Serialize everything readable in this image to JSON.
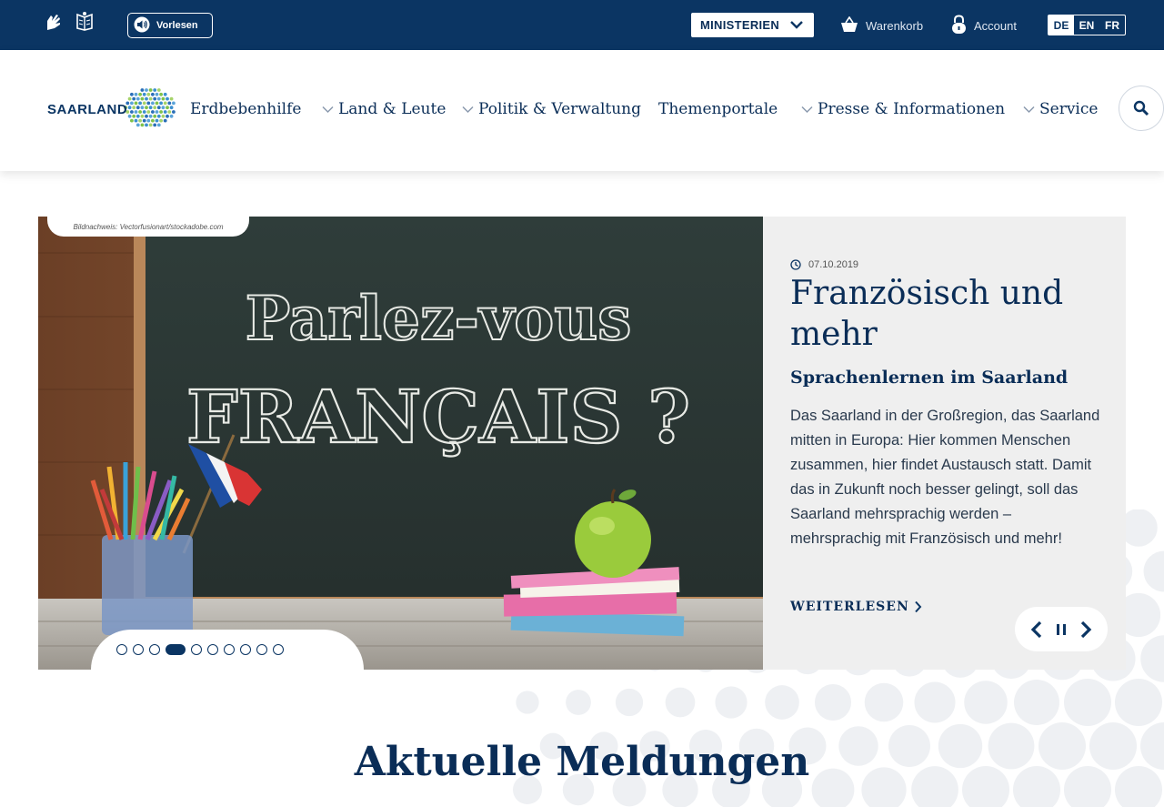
{
  "topbar": {
    "vorlesen_label": "Vorlesen",
    "ministerien_label": "MINISTERIEN",
    "cart_label": "Warenkorb",
    "account_label": "Account",
    "languages": [
      "DE",
      "EN",
      "FR"
    ],
    "active_language": "DE"
  },
  "logo": {
    "text": "SAARLAND"
  },
  "nav": {
    "items": [
      {
        "label": "Erdbebenhilfe",
        "has_dropdown": false
      },
      {
        "label": "Land & Leute",
        "has_dropdown": true
      },
      {
        "label": "Politik & Verwaltung",
        "has_dropdown": true
      },
      {
        "label": "Themenportale",
        "has_dropdown": false
      },
      {
        "label": "Presse & Informationen",
        "has_dropdown": true
      },
      {
        "label": "Service",
        "has_dropdown": true
      }
    ]
  },
  "slider": {
    "image_credit": "Bildnachweis: Vectorfusionart/stockadobe.com",
    "chalkboard_line1": "Parlez-vous",
    "chalkboard_line2": "FRANÇAIS ?",
    "date": "07.10.2019",
    "headline": "Französisch und mehr",
    "subheadline": "Sprachenlernen im Saarland",
    "body": "Das Saarland in der Großregion, das Saarland mitten in Europa: Hier kommen Menschen zusammen, hier findet Austausch statt. Damit das in Zukunft noch besser gelingt, soll das Saarland mehrsprachig werden – mehrsprachig mit Französisch und mehr!",
    "read_more_label": "WEITERLESEN",
    "slide_count": 10,
    "active_slide": 4
  },
  "section": {
    "title": "Aktuelle Meldungen"
  },
  "colors": {
    "primary": "#0b3563",
    "text": "#0a2d57",
    "panel": "#efefef"
  }
}
